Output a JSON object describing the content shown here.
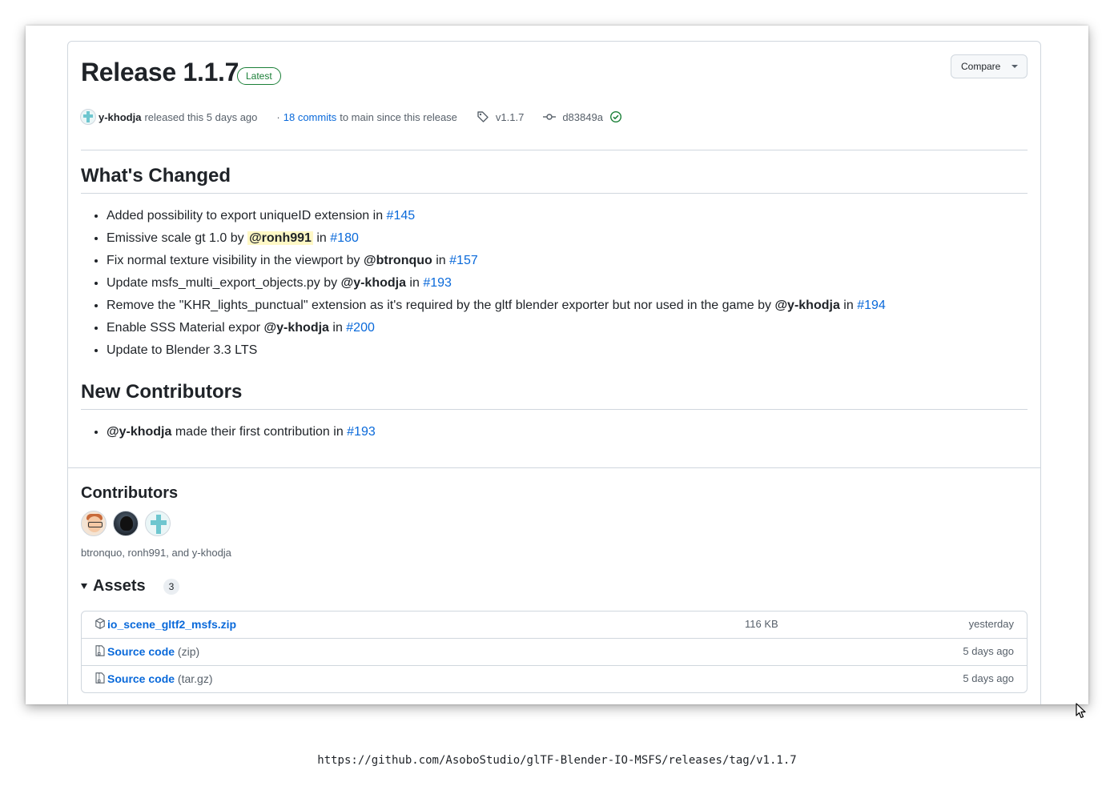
{
  "release": {
    "title": "Release 1.1.7",
    "badge": "Latest",
    "compare_label": "Compare",
    "author": "y-khodja",
    "released_text": "released this 5 days ago",
    "commits_prefix": "·",
    "commits_link": "18 commits",
    "commits_suffix": "to main since this release",
    "tag": "v1.1.7",
    "commit": "d83849a"
  },
  "whats_changed": {
    "heading": "What's Changed",
    "items": [
      {
        "text": "Added possibility to export uniqueID extension in ",
        "link": "#145"
      },
      {
        "text": "Emissive scale gt 1.0 by ",
        "mention": "@ronh991",
        "mid": " in ",
        "link": "#180"
      },
      {
        "text": "Fix normal texture visibility in the viewport by ",
        "mention": "@btronquo",
        "mid": " in ",
        "link": "#157"
      },
      {
        "text": "Update msfs_multi_export_objects.py by ",
        "mention": "@y-khodja",
        "mid": " in ",
        "link": "#193"
      },
      {
        "text": "Remove the \"KHR_lights_punctual\" extension as it's required by the gltf blender exporter but nor used in the game by ",
        "mention": "@y-khodja",
        "mid": " in ",
        "link": "#194"
      },
      {
        "text": "Enable SSS Material expor ",
        "mention": "@y-khodja",
        "mid": " in ",
        "link": "#200"
      },
      {
        "text": "Update to Blender 3.3 LTS"
      }
    ]
  },
  "new_contributors": {
    "heading": "New Contributors",
    "items": [
      {
        "mention": "@y-khodja",
        "text": " made their first contribution in ",
        "link": "#193"
      }
    ]
  },
  "contributors": {
    "heading": "Contributors",
    "names": "btronquo, ronh991, and y-khodja"
  },
  "assets": {
    "heading": "Assets",
    "count": "3",
    "rows": [
      {
        "name": "io_scene_gltf2_msfs.zip",
        "sub": "",
        "size": "116 KB",
        "date": "yesterday"
      },
      {
        "name": "Source code",
        "sub": "(zip)",
        "size": "",
        "date": "5 days ago"
      },
      {
        "name": "Source code",
        "sub": "(tar.gz)",
        "size": "",
        "date": "5 days ago"
      }
    ]
  },
  "url": "https://github.com/AsoboStudio/glTF-Blender-IO-MSFS/releases/tag/v1.1.7"
}
